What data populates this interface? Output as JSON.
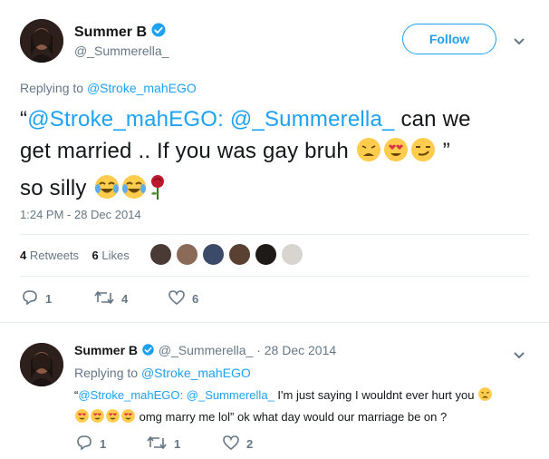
{
  "tweet": {
    "display_name": "Summer B",
    "handle": "@_Summerella_",
    "follow_label": "Follow",
    "replying_prefix": "Replying to",
    "replying_handle": "@Stroke_mahEGO",
    "text_open_quote": "“",
    "mention_1": "@Stroke_mahEGO:",
    "mention_2": "@_Summerella_",
    "text_part_1": "can we",
    "text_line_2": "get married .. If you was gay bruh",
    "text_close_quote": "”",
    "text_line_3": "so silly",
    "timestamp": "1:24 PM - 28 Dec 2014",
    "retweet_count": "4",
    "retweet_label": "Retweets",
    "like_count": "6",
    "like_label": "Likes",
    "actions": {
      "replies": "1",
      "retweets": "4",
      "likes": "6"
    }
  },
  "reply": {
    "display_name": "Summer B",
    "handle": "@_Summerella_",
    "separator": "·",
    "date": "28 Dec 2014",
    "replying_prefix": "Replying to",
    "replying_handle": "@Stroke_mahEGO",
    "open_quote": "“",
    "mention_1": "@Stroke_mahEGO:",
    "mention_2": "@_Summerella_",
    "text_1": "I'm just saying I wouldnt ever hurt you",
    "text_2": "omg marry me lol” ok what day  would our marriage be on ?",
    "actions": {
      "replies": "1",
      "retweets": "1",
      "likes": "2"
    }
  },
  "colors": {
    "accent": "#1da1f2",
    "muted": "#657786",
    "text": "#14171a",
    "divider": "#e6ecf0"
  },
  "icons": [
    "verified-badge-icon",
    "chevron-down-icon",
    "reply-icon",
    "retweet-icon",
    "heart-icon",
    "weary-face-emoji",
    "heart-eyes-emoji",
    "smirk-emoji",
    "tears-of-joy-emoji",
    "rose-emoji"
  ]
}
